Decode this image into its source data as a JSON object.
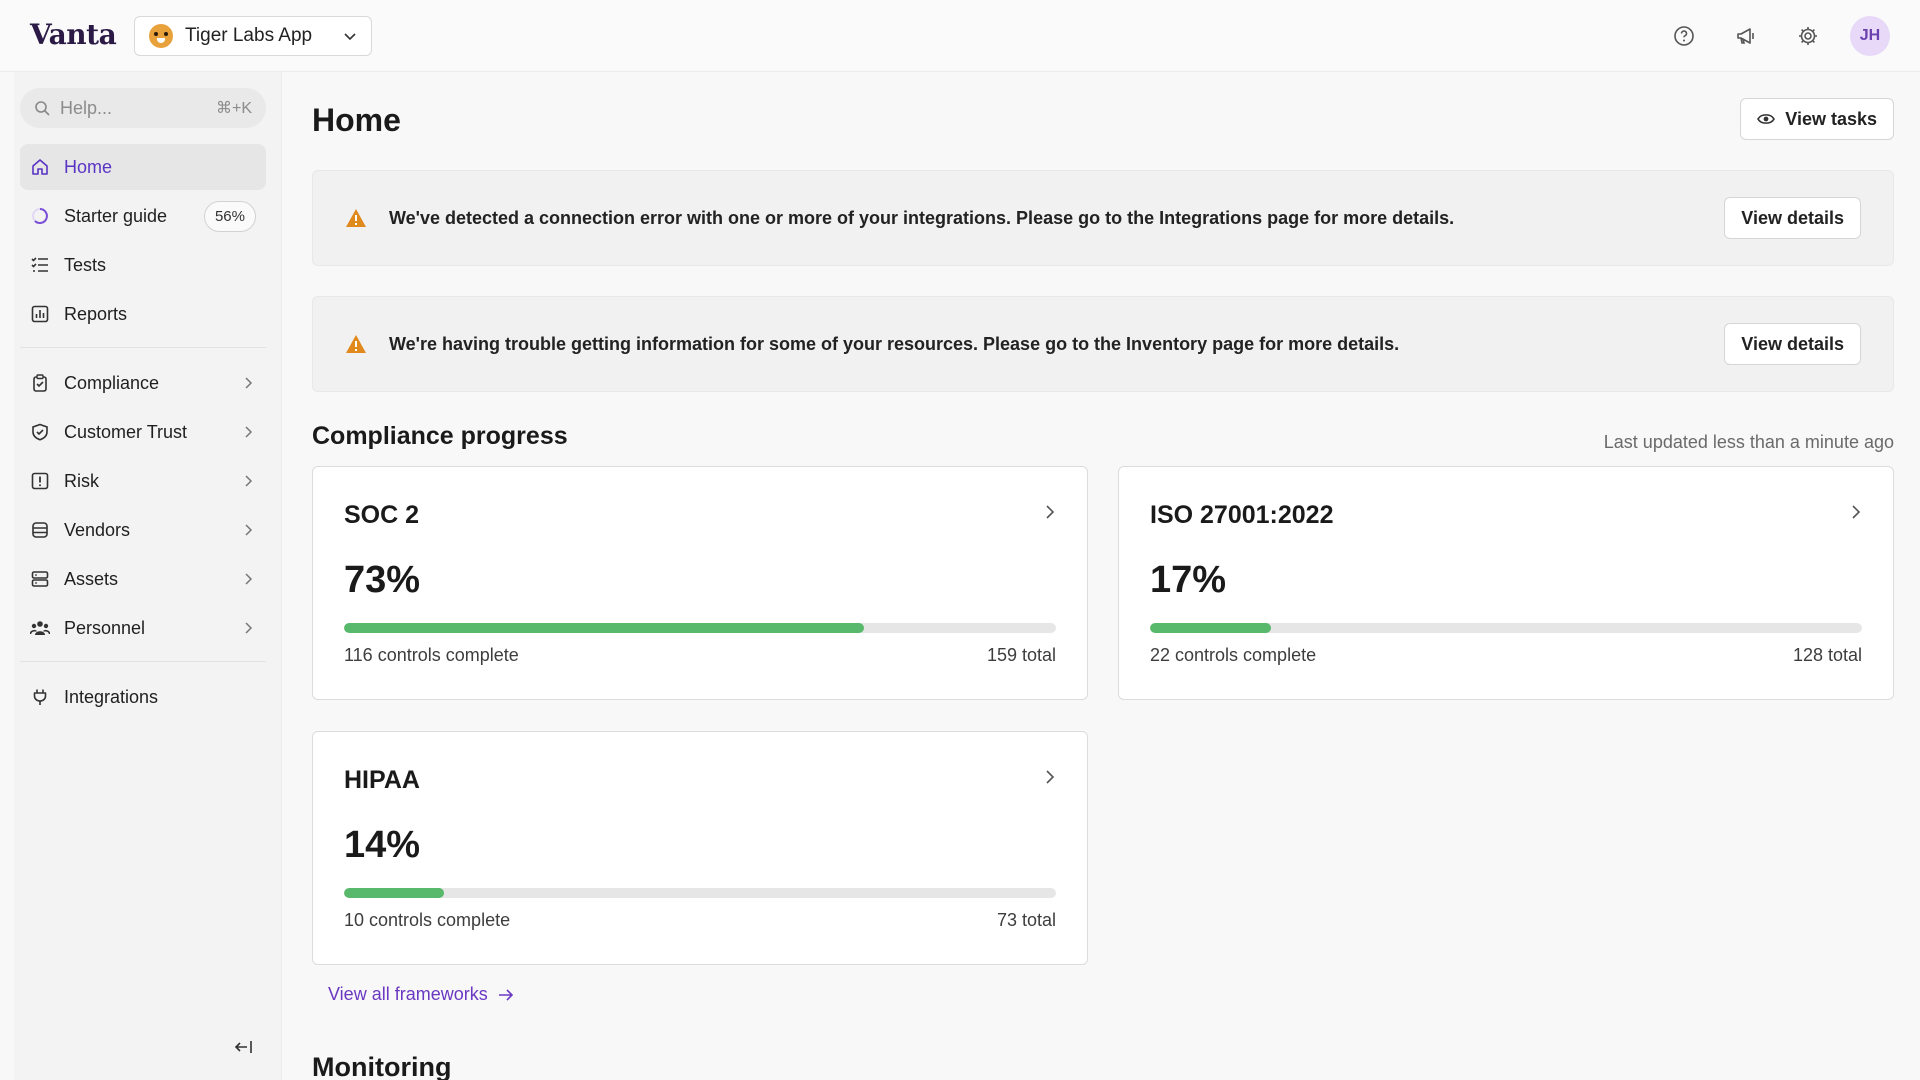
{
  "app": {
    "logo": "Vanta",
    "workspace": "Tiger Labs App",
    "avatar_initials": "JH"
  },
  "search": {
    "placeholder": "Help...",
    "shortcut": "⌘+K"
  },
  "sidebar": {
    "items": [
      {
        "label": "Home",
        "icon": "home-icon",
        "active": true
      },
      {
        "label": "Starter guide",
        "icon": "progress-ring-icon",
        "badge": "56%"
      },
      {
        "label": "Tests",
        "icon": "checklist-icon"
      },
      {
        "label": "Reports",
        "icon": "bar-chart-icon"
      },
      {
        "label": "Compliance",
        "icon": "clipboard-check-icon"
      },
      {
        "label": "Customer Trust",
        "icon": "shield-check-icon"
      },
      {
        "label": "Risk",
        "icon": "exclamation-square-icon"
      },
      {
        "label": "Vendors",
        "icon": "database-icon"
      },
      {
        "label": "Assets",
        "icon": "server-icon"
      },
      {
        "label": "Personnel",
        "icon": "people-icon"
      },
      {
        "label": "Integrations",
        "icon": "plug-icon"
      }
    ]
  },
  "header": {
    "title": "Home",
    "view_tasks_label": "View tasks"
  },
  "alerts": [
    {
      "text": "We've detected a connection error with one or more of your integrations. Please go to the Integrations page for more details.",
      "button": "View details"
    },
    {
      "text": "We're having trouble getting information for some of your resources. Please go to the Inventory page for more details.",
      "button": "View details"
    }
  ],
  "compliance": {
    "title": "Compliance progress",
    "updated": "Last updated less than a minute ago",
    "frameworks": [
      {
        "name": "SOC 2",
        "percent_label": "73%",
        "progress": 0.73,
        "complete": "116 controls complete",
        "total": "159 total"
      },
      {
        "name": "ISO 27001:2022",
        "percent_label": "17%",
        "progress": 0.17,
        "complete": "22 controls complete",
        "total": "128 total"
      },
      {
        "name": "HIPAA",
        "percent_label": "14%",
        "progress": 0.14,
        "complete": "10 controls complete",
        "total": "73 total"
      }
    ],
    "view_all": "View all frameworks"
  },
  "monitoring": {
    "title": "Monitoring"
  },
  "colors": {
    "accent": "#5a34c4",
    "progress": "#58b86b",
    "warning": "#e08a1e"
  }
}
